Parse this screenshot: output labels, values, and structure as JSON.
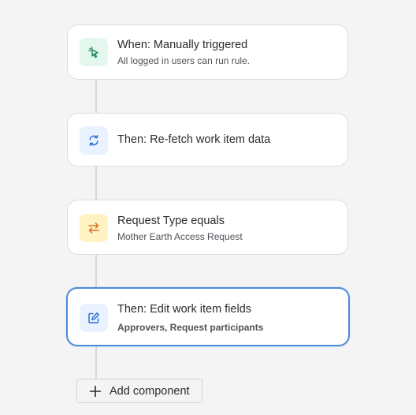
{
  "colors": {
    "trigger_icon_bg": "#e3f7ee",
    "trigger_icon": "#1f8a5b",
    "action_icon_bg": "#e9f2fe",
    "action_icon": "#2f6fd6",
    "condition_icon_bg": "#fff3c4",
    "condition_icon": "#e0701c",
    "selected_border": "#4c8bdc"
  },
  "rule_components": [
    {
      "title": "When: Manually triggered",
      "subtitle": "All logged in users can run rule.",
      "icon": "cursor-click-icon",
      "kind": "trigger"
    },
    {
      "title": "Then: Re-fetch work item data",
      "subtitle": "",
      "icon": "refresh-icon",
      "kind": "action"
    },
    {
      "title": "Request Type equals",
      "subtitle": "Mother Earth Access Request",
      "icon": "swap-arrows-icon",
      "kind": "condition"
    },
    {
      "title": "Then: Edit work item fields",
      "subtitle": "Approvers, Request participants",
      "icon": "edit-icon",
      "kind": "action",
      "selected": true
    }
  ],
  "add_component": {
    "label": "Add component",
    "icon": "plus-icon"
  }
}
